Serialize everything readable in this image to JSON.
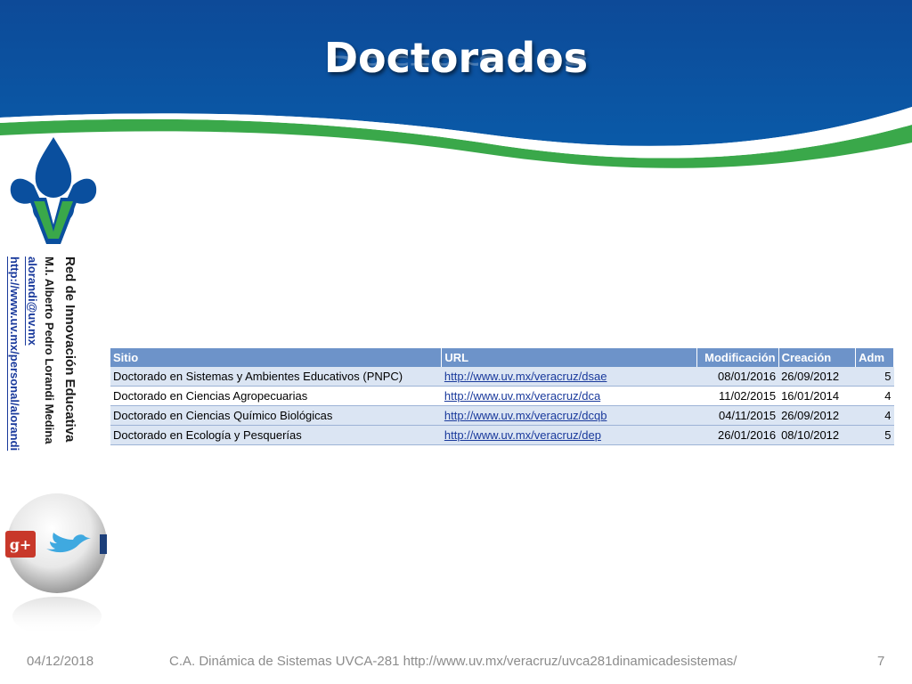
{
  "slide": {
    "title": "Doctorados",
    "colors": {
      "header_blue": "#0a4f9e",
      "accent_green": "#3aa84a",
      "table_header": "#6d93c9",
      "link": "#1a3a9c"
    }
  },
  "sidebar": {
    "network": "Red de Innovación Educativa",
    "author": "M.I. Alberto Pedro Lorandi Medina",
    "email": "alorandi@uv.mx",
    "site": "http://www.uv.mx/personal/alorandi",
    "logo_icon": "uv-fleur-de-lis-logo",
    "social_icons": [
      "google-plus-icon",
      "twitter-icon"
    ]
  },
  "table": {
    "headers": {
      "site": "Sitio",
      "url": "URL",
      "modified": "Modificación",
      "created": "Creación",
      "adm": "Adm"
    },
    "rows": [
      {
        "site": "Doctorado en Sistemas y Ambientes Educativos (PNPC)",
        "url": "http://www.uv.mx/veracruz/dsae",
        "modified": "08/01/2016",
        "created": "26/09/2012",
        "adm": "5"
      },
      {
        "site": "Doctorado en Ciencias Agropecuarias",
        "url": "http://www.uv.mx/veracruz/dca",
        "modified": "11/02/2015",
        "created": "16/01/2014",
        "adm": "4"
      },
      {
        "site": "Doctorado en Ciencias Químico Biológicas",
        "url": "http://www.uv.mx/veracruz/dcqb",
        "modified": "04/11/2015",
        "created": "26/09/2012",
        "adm": "4"
      },
      {
        "site": "Doctorado en Ecología y Pesquerías",
        "url": "http://www.uv.mx/veracruz/dep",
        "modified": "26/01/2016",
        "created": "08/10/2012",
        "adm": "5"
      }
    ]
  },
  "footer": {
    "date": "04/12/2018",
    "course": "C.A. Dinámica de Sistemas UVCA-281 http://www.uv.mx/veracruz/uvca281dinamicadesistemas/",
    "page": "7"
  }
}
